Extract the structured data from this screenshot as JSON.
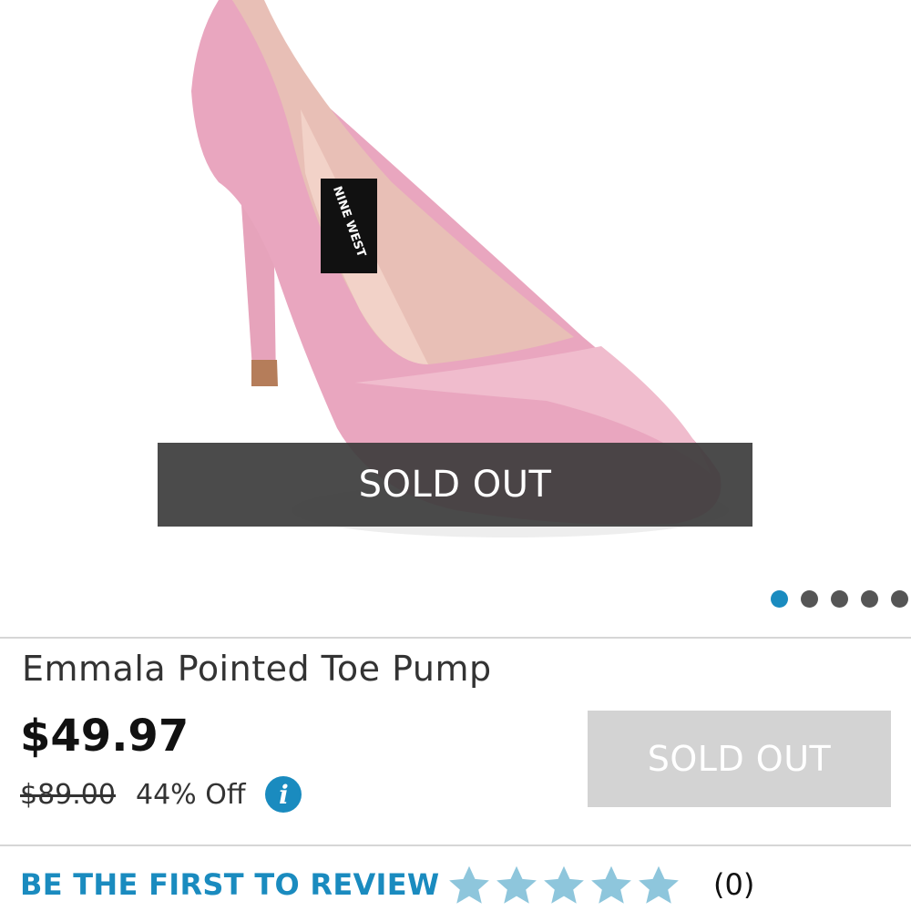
{
  "product": {
    "image": {
      "brand_label": "NINE WEST",
      "sold_out_overlay": "SOLD OUT",
      "carousel_dots": 5,
      "active_dot": 0
    },
    "title": "Emmala Pointed Toe Pump",
    "price": "$49.97",
    "original_price": "$89.00",
    "discount": "44% Off",
    "info_icon": "info-icon",
    "sold_out_button": "SOLD OUT"
  },
  "reviews": {
    "link_text": "BE THE FIRST TO REVIEW",
    "rating": 0,
    "max_rating": 5,
    "count_text": "(0)"
  },
  "colors": {
    "accent": "#1a8bbf",
    "star": "#8ec6dc",
    "overlay": "#3c3c3c",
    "button_disabled": "#d3d3d3",
    "shoe": "#e9a6bf"
  }
}
